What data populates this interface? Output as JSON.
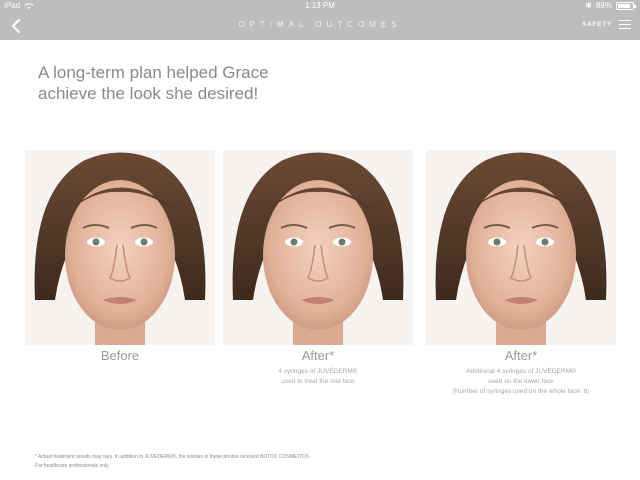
{
  "status_bar": {
    "device": "iPad",
    "time": "1:13 PM",
    "battery": "88%",
    "battery_level": 0.88
  },
  "nav": {
    "title": "OPTIMAL OUTCOMES",
    "safety_label": "SAFETY"
  },
  "headline": {
    "line1": "A long-term plan helped Grace",
    "line2": "achieve the look she desired!"
  },
  "photos": [
    {
      "caption": "Before",
      "sub": []
    },
    {
      "caption": "After*",
      "sub": [
        "4 syringes of JUVÉDERM®",
        "used to treat the mid face"
      ]
    },
    {
      "caption": "After*",
      "sub": [
        "Additional 4 syringes of JUVÉDERM®",
        "used on the lower face",
        "(Number of syringes used on the whole face: 8)"
      ]
    }
  ],
  "footnote": {
    "line1": "* Actual treatment results may vary. In addition to JUVÉDERM®, the woman in these photos received BOTOX COSMETIC®.",
    "line2": "For healthcare professionals only."
  },
  "colors": {
    "bar": "#bdbdbd",
    "text_gray": "#8a8a8a"
  },
  "icons": [
    "wifi-icon",
    "bluetooth-icon",
    "battery-icon",
    "back-chevron-icon",
    "menu-icon"
  ]
}
